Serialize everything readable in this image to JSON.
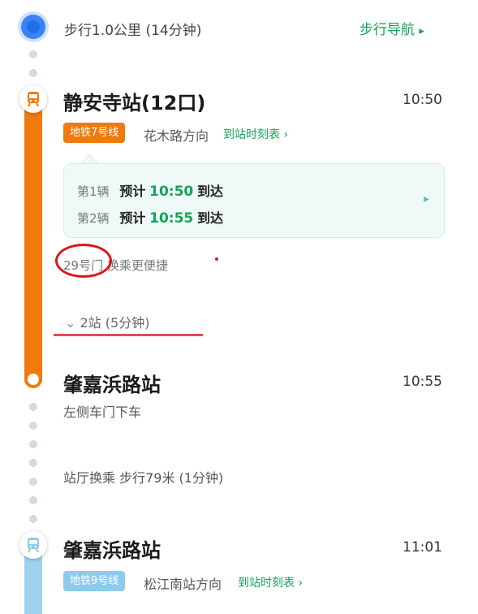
{
  "walk": {
    "text": "步行1.0公里 (14分钟)",
    "nav_label": "步行导航",
    "nav_arrow": "▸"
  },
  "station1": {
    "name": "静安寺站(12口)",
    "time": "10:50",
    "line_badge": "地铁7号线",
    "line_color": "#f07a0e",
    "direction": "花木路方向",
    "timetable_label": "到站时刻表",
    "timetable_arrow": "›"
  },
  "arrivals": [
    {
      "label": "第1辆",
      "prefix": "预计",
      "time": "10:50",
      "suffix": "到达"
    },
    {
      "label": "第2辆",
      "prefix": "预计",
      "time": "10:55",
      "suffix": "到达"
    }
  ],
  "card_arrow": "▸",
  "transfer_hint": "29号门 换乘更便捷",
  "stops": {
    "chevron": "⌄",
    "text": "2站 (5分钟)"
  },
  "station2": {
    "name": "肇嘉浜路站",
    "time": "10:55",
    "exit_note": "左侧车门下车"
  },
  "transfer": {
    "text": "站厅换乘 步行79米 (1分钟)"
  },
  "station3": {
    "name": "肇嘉浜路站",
    "time": "11:01",
    "line_badge": "地铁9号线",
    "line_color": "#8ccbee",
    "direction": "松江南站方向",
    "timetable_label": "到站时刻表",
    "timetable_arrow": "›"
  },
  "colors": {
    "accent_green": "#13a35a",
    "walk_blue": "#1f6fe8",
    "annotation_red": "#e01515"
  }
}
